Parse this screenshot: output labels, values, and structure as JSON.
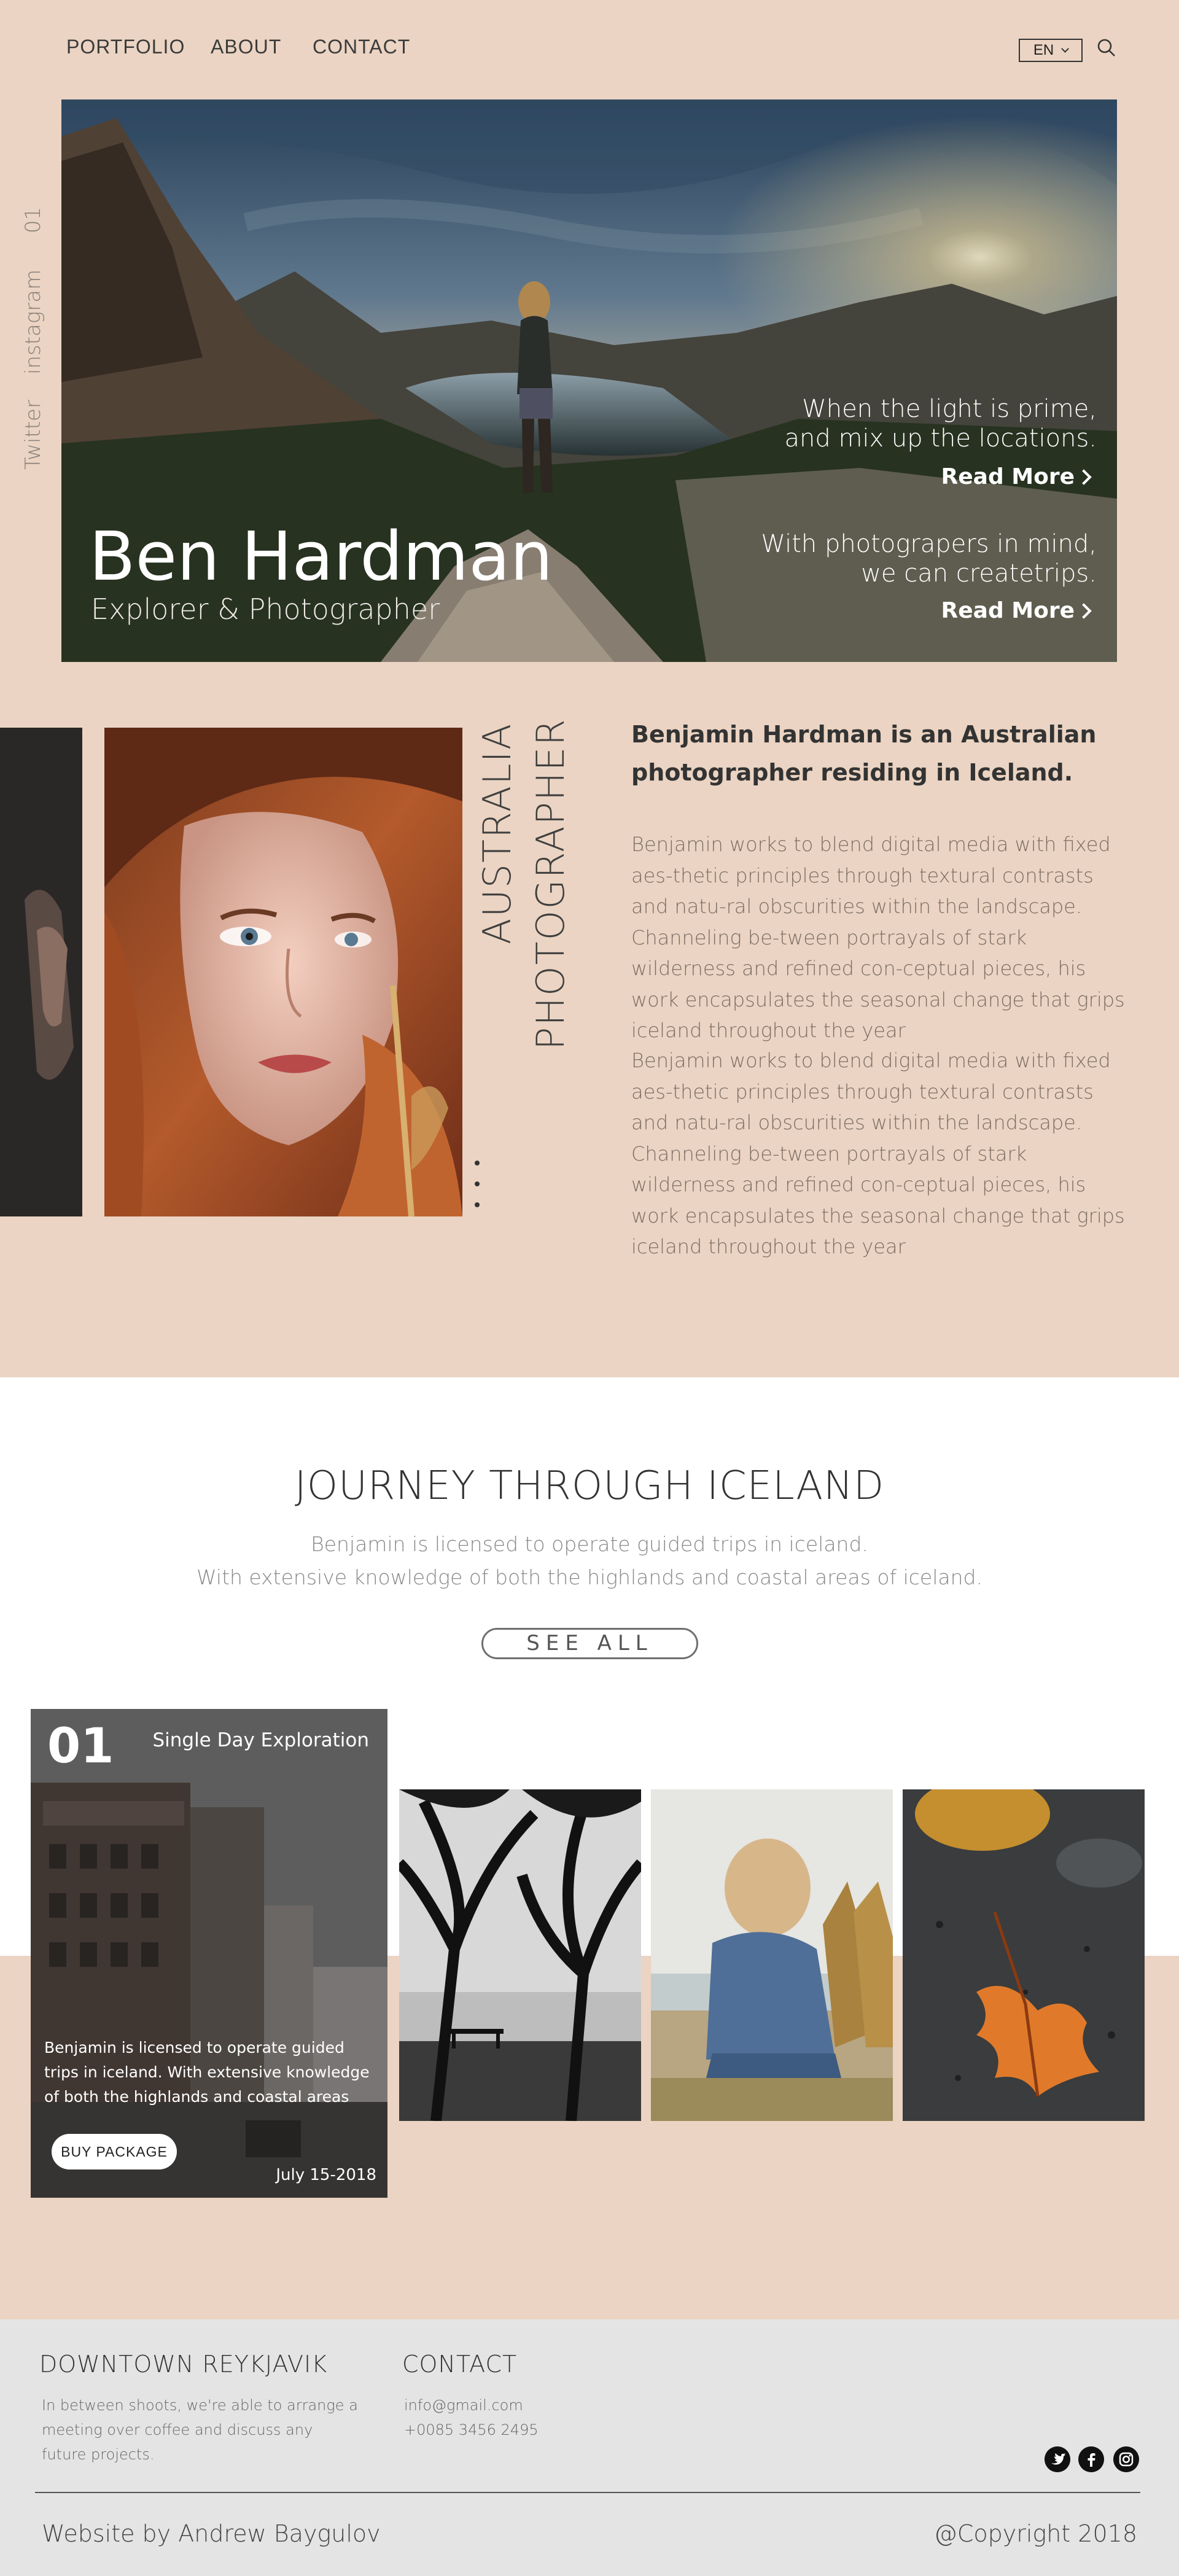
{
  "nav": {
    "items": [
      "PORTFOLIO",
      "ABOUT",
      "CONTACT"
    ],
    "language": "EN"
  },
  "side_links": {
    "number": "01",
    "instagram": "instagram",
    "twitter": "Twitter"
  },
  "hero": {
    "title": "Ben Hardman",
    "subtitle": "Explorer & Photographer",
    "blurb1": [
      "When the light is prime,",
      "and mix up the locations."
    ],
    "blurb2": [
      "With photograpers in mind,",
      "we can createtrips."
    ],
    "read_more": "Read More"
  },
  "about": {
    "vertical1": "AUSTRALIA",
    "vertical2": "PHOTOGRAPHER",
    "heading": "Benjamin Hardman is an Australian photographer residing in Iceland.",
    "paragraph1": "Benjamin works to blend digital media with fixed aes-thetic principles through textural contrasts and natu-ral obscurities within the landscape. Channeling be-tween portrayals of stark wilderness and refined con-ceptual pieces, his work encapsulates the seasonal change that grips iceland throughout the year",
    "paragraph2": "Benjamin works to blend digital media with fixed aes-thetic principles through textural contrasts and natu-ral obscurities within the landscape. Channeling be-tween portrayals of stark wilderness and refined con-ceptual pieces, his work encapsulates the seasonal change that grips iceland throughout the year"
  },
  "journey": {
    "title": "JOURNEY THROUGH ICELAND",
    "line1": "Benjamin is licensed to operate guided trips in iceland.",
    "line2": "With extensive knowledge of both the highlands and coastal areas of iceland.",
    "see_all": "SEE ALL"
  },
  "card": {
    "number": "01",
    "label": "Single Day Exploration",
    "description": "Benjamin is licensed to operate guided trips in iceland. With extensive knowledge of both the highlands and coastal areas",
    "button": "BUY PACKAGE",
    "date": "July 15-2018"
  },
  "footer": {
    "location_heading": "DOWNTOWN REYKJAVIK",
    "location_text": "In between shoots, we're able to arrange a meeting over coffee and discuss any future projects.",
    "contact_heading": "CONTACT",
    "email": "info@gmail.com",
    "phone": "+0085 3456 2495",
    "credit": "Website by Andrew Baygulov",
    "copyright": "@Copyright 2018",
    "social_icons": [
      "twitter-icon",
      "facebook-icon",
      "instagram-icon"
    ]
  },
  "colors": {
    "background": "#ebd4c3",
    "footer": "#e4e4e4",
    "text_dark": "#333333",
    "text_muted": "#7d6d64"
  }
}
